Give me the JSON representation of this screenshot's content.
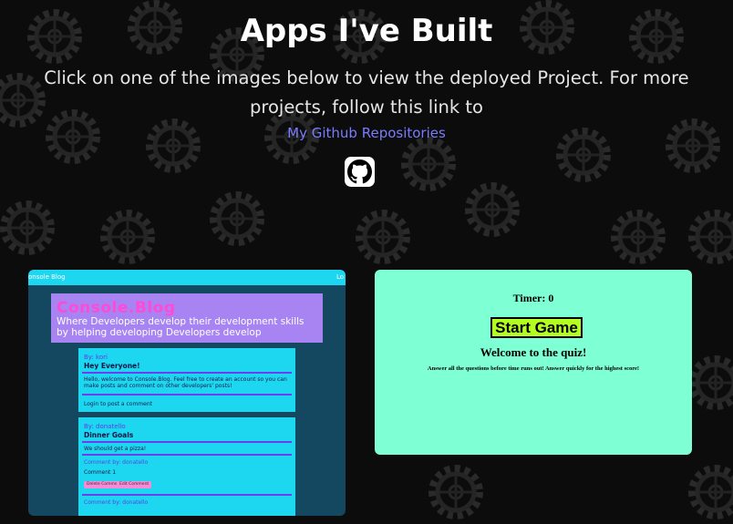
{
  "page": {
    "title": "Apps I've Built",
    "intro": "Click on one of the images below to view the deployed Project. For more projects, follow this link to",
    "repo_link": "My Github Repositories",
    "github_icon": "github-icon"
  },
  "colors": {
    "background": "#0c0c0c",
    "link": "#7a7cff",
    "blog_bg": "#144760",
    "blog_accent": "#1dd6f0",
    "quiz_bg": "#7fffd4",
    "quiz_button": "#b4ff22"
  },
  "projects": {
    "blog": {
      "nav_brand": "onsole Blog",
      "nav_right": "Lo",
      "hero_title": "Console.Blog",
      "hero_line1": "Where Developers develop their development skills",
      "hero_line2": "by helping developing Developers develop",
      "post1": {
        "by": "By: kori",
        "title": "Hey Everyone!",
        "body": "Hello, welcome to Console.Blog. Feel free to create an account so you can make posts and comment on other developers' posts!",
        "footer": "Login to post a comment"
      },
      "post2": {
        "by": "By: donatello",
        "title": "Dinner Goals",
        "body": "We should get a pizza!",
        "comment_by": "Comment by: donatello",
        "comment_text": "Comment 1",
        "delete_label": "Delete Comment",
        "edit_label": "Edit Comment",
        "comment2_by": "Comment by: donatello"
      }
    },
    "quiz": {
      "timer": "Timer: 0",
      "start": "Start Game",
      "welcome": "Welcome to the quiz!",
      "description": "Answer all the questions before time runs out! Answer quickly for the highest score!"
    }
  }
}
